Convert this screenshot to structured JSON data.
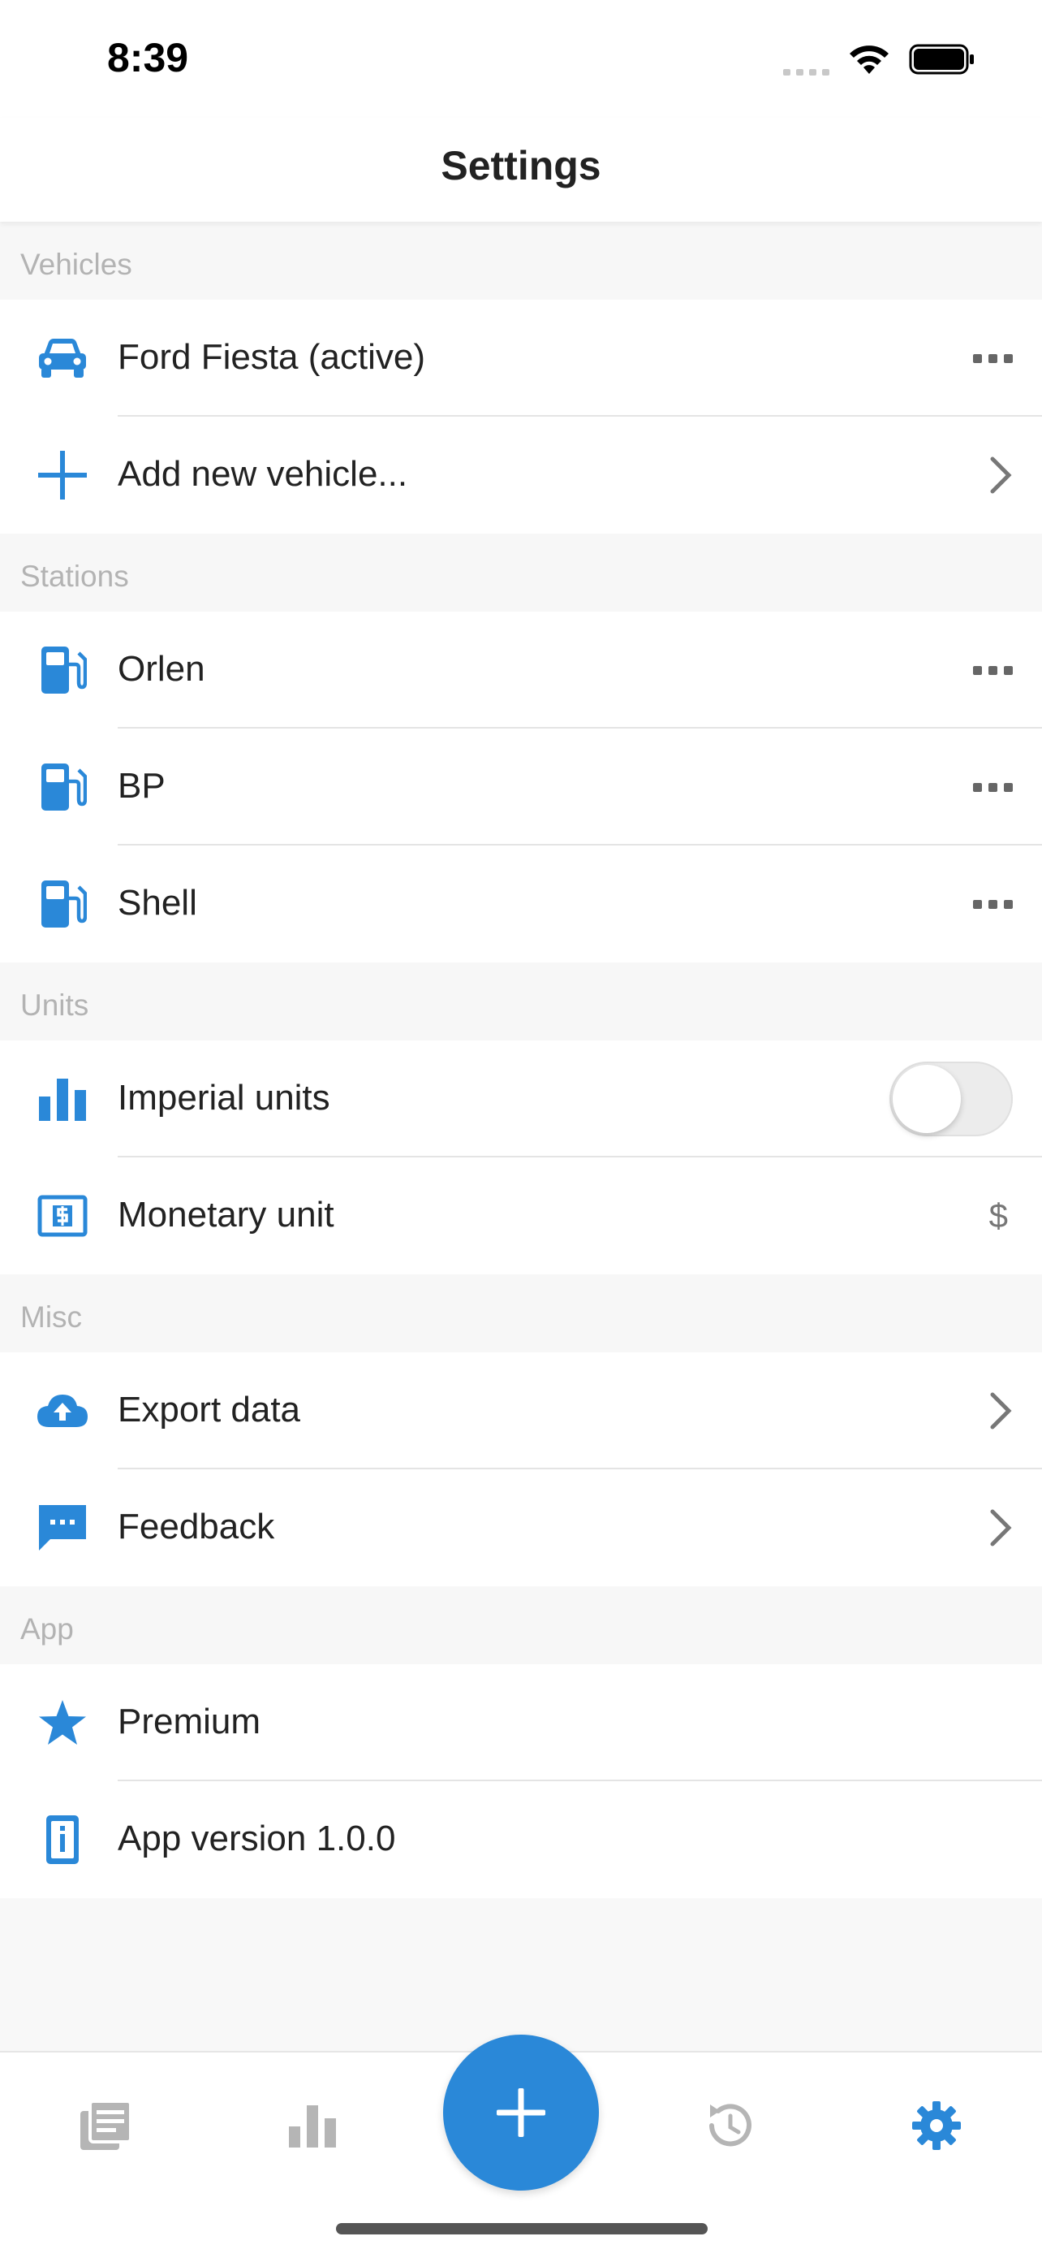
{
  "status_bar": {
    "time": "8:39"
  },
  "nav": {
    "title": "Settings"
  },
  "sections": {
    "vehicles": {
      "header": "Vehicles",
      "vehicle_label": "Ford Fiesta (active)",
      "add_label": "Add new vehicle..."
    },
    "stations": {
      "header": "Stations",
      "items": [
        {
          "label": "Orlen"
        },
        {
          "label": "BP"
        },
        {
          "label": "Shell"
        }
      ]
    },
    "units": {
      "header": "Units",
      "imperial_label": "Imperial units",
      "imperial_enabled": false,
      "monetary_label": "Monetary unit",
      "monetary_value": "$"
    },
    "misc": {
      "header": "Misc",
      "export_label": "Export data",
      "feedback_label": "Feedback"
    },
    "app": {
      "header": "App",
      "premium_label": "Premium",
      "version_label": "App version 1.0.0"
    }
  },
  "tab_bar": {
    "tabs": [
      {
        "icon": "logbook-icon",
        "active": false
      },
      {
        "icon": "stats-icon",
        "active": false
      },
      {
        "icon": "history-icon",
        "active": false
      },
      {
        "icon": "gear-icon",
        "active": true
      }
    ],
    "fab_icon": "plus-icon"
  },
  "colors": {
    "accent": "#2a88d8",
    "section_background": "#f7f7f7",
    "section_text": "#b3b3b3",
    "inactive_tab": "#b5b5b5"
  }
}
